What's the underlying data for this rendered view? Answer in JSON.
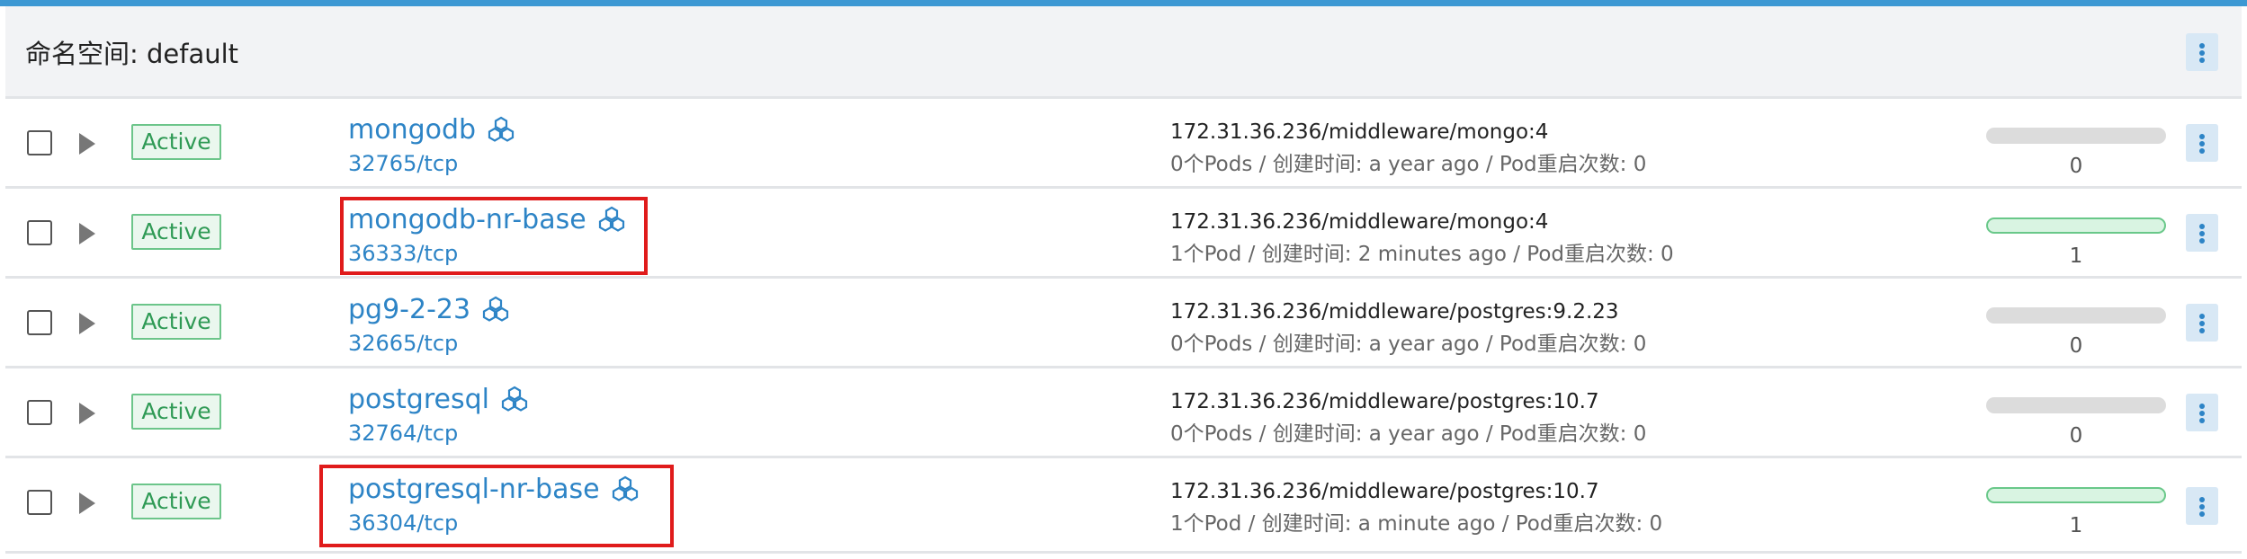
{
  "namespace": {
    "title": "命名空间: default"
  },
  "workloads": [
    {
      "status": "Active",
      "name": "mongodb",
      "port": "32765/tcp",
      "image": "172.31.36.236/middleware/mongo:4",
      "meta": "0个Pods / 创建时间: a year ago / Pod重启次数: 0",
      "pod_count": "0",
      "health": 0,
      "highlighted": false
    },
    {
      "status": "Active",
      "name": "mongodb-nr-base",
      "port": "36333/tcp",
      "image": "172.31.36.236/middleware/mongo:4",
      "meta": "1个Pod / 创建时间: 2 minutes ago / Pod重启次数: 0",
      "pod_count": "1",
      "health": 1,
      "highlighted": true
    },
    {
      "status": "Active",
      "name": "pg9-2-23",
      "port": "32665/tcp",
      "image": "172.31.36.236/middleware/postgres:9.2.23",
      "meta": "0个Pods / 创建时间: a year ago / Pod重启次数: 0",
      "pod_count": "0",
      "health": 0,
      "highlighted": false
    },
    {
      "status": "Active",
      "name": "postgresql",
      "port": "32764/tcp",
      "image": "172.31.36.236/middleware/postgres:10.7",
      "meta": "0个Pods / 创建时间: a year ago / Pod重启次数: 0",
      "pod_count": "0",
      "health": 0,
      "highlighted": false
    },
    {
      "status": "Active",
      "name": "postgresql-nr-base",
      "port": "36304/tcp",
      "image": "172.31.36.236/middleware/postgres:10.7",
      "meta": "1个Pod / 创建时间: a minute ago / Pod重启次数: 0",
      "pod_count": "1",
      "health": 1,
      "highlighted": true
    }
  ],
  "colors": {
    "link": "#2d84c6",
    "active_badge": "#2f9a55",
    "highlight": "#e01b1b",
    "accent_bar": "#3d98d3"
  }
}
